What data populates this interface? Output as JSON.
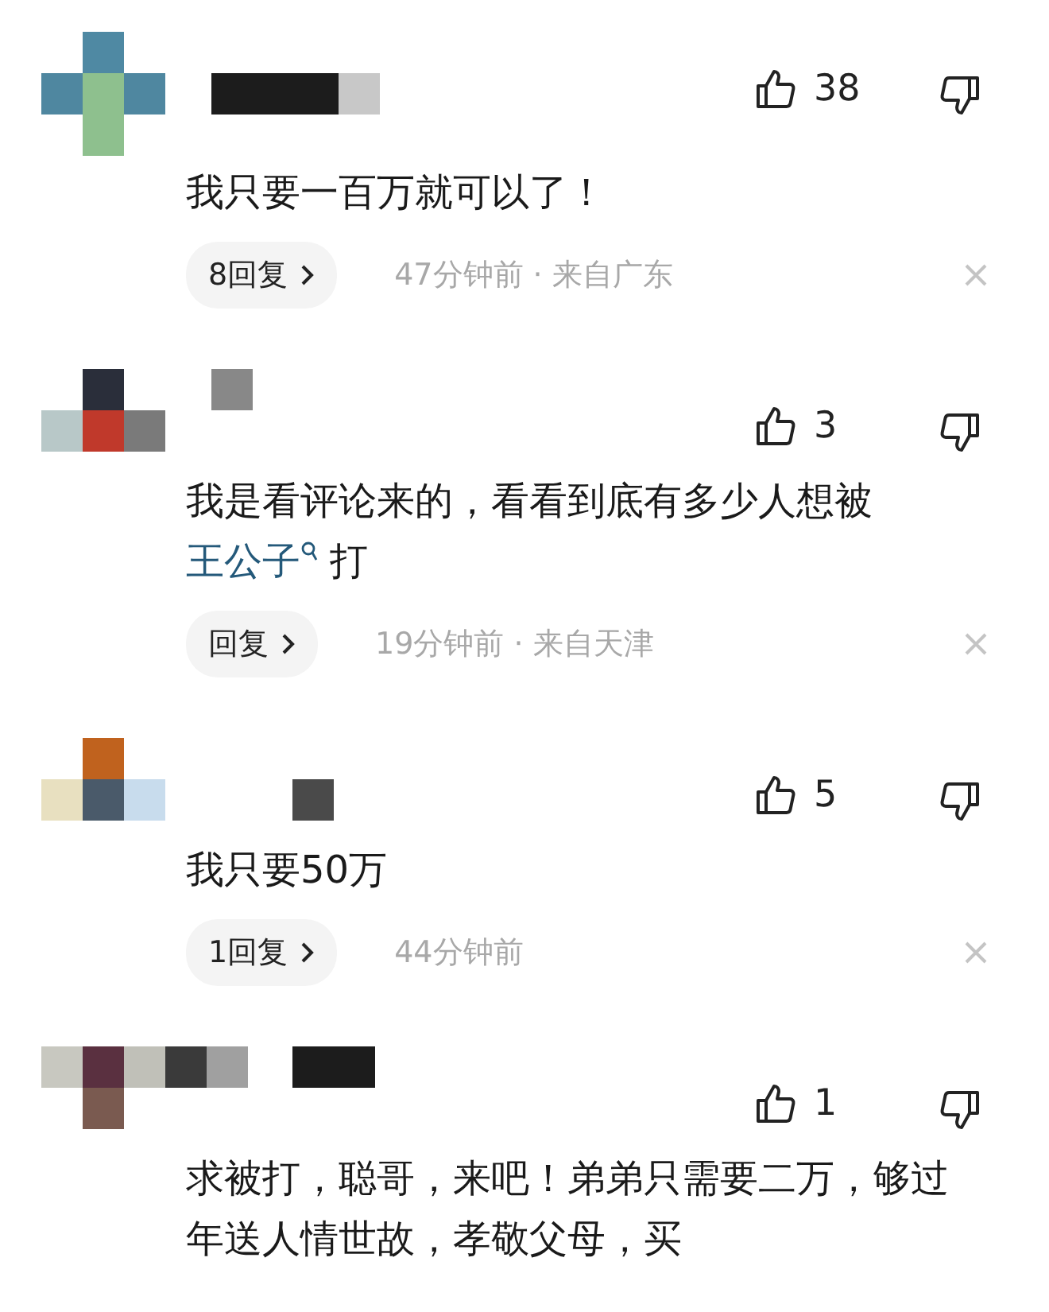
{
  "comments": [
    {
      "likes": "38",
      "body": [
        {
          "kind": "plain",
          "text": "我只要一百万就可以了！"
        }
      ],
      "replies": "8回复",
      "meta": "47分钟前 · 来自广东"
    },
    {
      "likes": "3",
      "body": [
        {
          "kind": "plain",
          "text": "我是看评论来的，看看到底有多少人想被"
        },
        {
          "kind": "link",
          "text": "王公子"
        },
        {
          "kind": "plain",
          "text": " 打"
        }
      ],
      "replies": "回复",
      "meta": "19分钟前 · 来自天津"
    },
    {
      "likes": "5",
      "body": [
        {
          "kind": "plain",
          "text": "我只要50万"
        }
      ],
      "replies": "1回复",
      "meta": "44分钟前"
    },
    {
      "likes": "1",
      "body": [
        {
          "kind": "plain",
          "text": "求被打，聪哥，来吧！弟弟只需要二万，够过年送人情世故，孝敬父母，买"
        }
      ]
    }
  ]
}
